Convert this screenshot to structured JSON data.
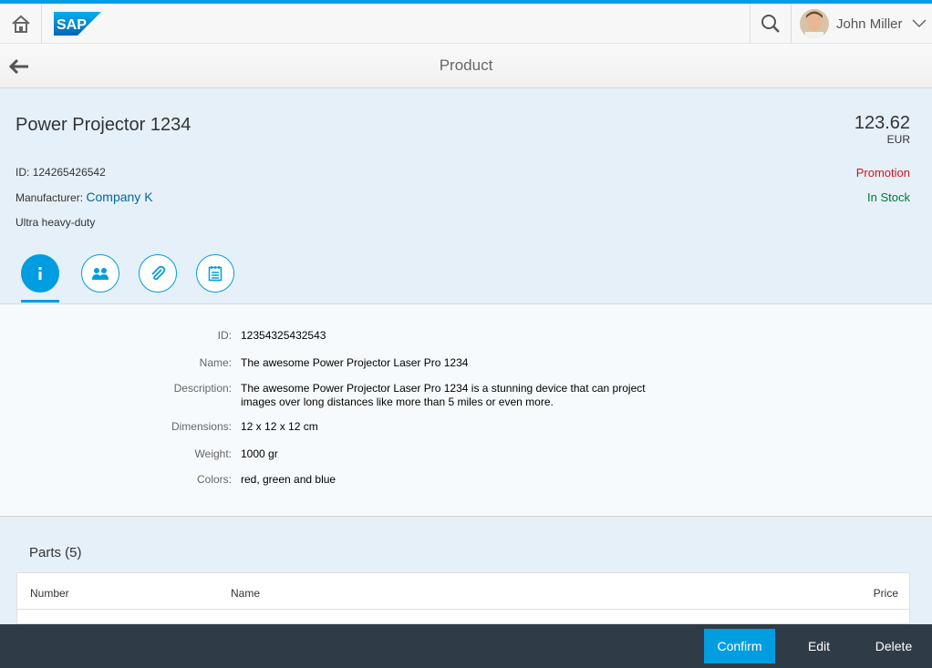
{
  "shell": {
    "logo_text": "SAP",
    "user_name": "John Miller",
    "icons": {
      "home": "home-icon",
      "search": "search-icon",
      "user_menu": "chevron-down-icon"
    }
  },
  "page": {
    "title": "Product",
    "back_icon": "back-arrow-icon"
  },
  "object": {
    "title": "Power Projector 1234",
    "price": "123.62",
    "currency": "EUR",
    "id_label": "ID:",
    "id_value": "124265426542",
    "manufacturer_label": "Manufacturer:",
    "manufacturer_value": "Company K",
    "description": "Ultra heavy-duty",
    "status_promotion": "Promotion",
    "status_stock": "In Stock",
    "status_colors": {
      "promotion": "#cc1919",
      "stock": "#007833"
    },
    "tabs": [
      {
        "icon": "info-icon",
        "active": true
      },
      {
        "icon": "group-icon",
        "active": false
      },
      {
        "icon": "attachment-icon",
        "active": false
      },
      {
        "icon": "notes-icon",
        "active": false
      }
    ]
  },
  "form": {
    "rows": [
      {
        "label": "ID:",
        "value": "12354325432543"
      },
      {
        "label": "Name:",
        "value": "The awesome Power Projector Laser Pro 1234"
      },
      {
        "label": "Description:",
        "value": "The awesome Power Projector Laser Pro 1234 is a stunning device that can project images over long distances like more than 5 miles or even more."
      },
      {
        "label": "Dimensions:",
        "value": "12 x 12 x 12 cm"
      },
      {
        "label": "Weight:",
        "value": "1000 gr"
      },
      {
        "label": "Colors:",
        "value": "red, green and blue"
      }
    ]
  },
  "parts": {
    "title": "Parts (5)",
    "columns": [
      "Number",
      "Name",
      "Price"
    ]
  },
  "footer": {
    "confirm": "Confirm",
    "edit": "Edit",
    "delete": "Delete"
  },
  "colors": {
    "accent": "#009de0",
    "footer_bg": "#2f3c48",
    "header_bg": "#e6f0f8"
  }
}
